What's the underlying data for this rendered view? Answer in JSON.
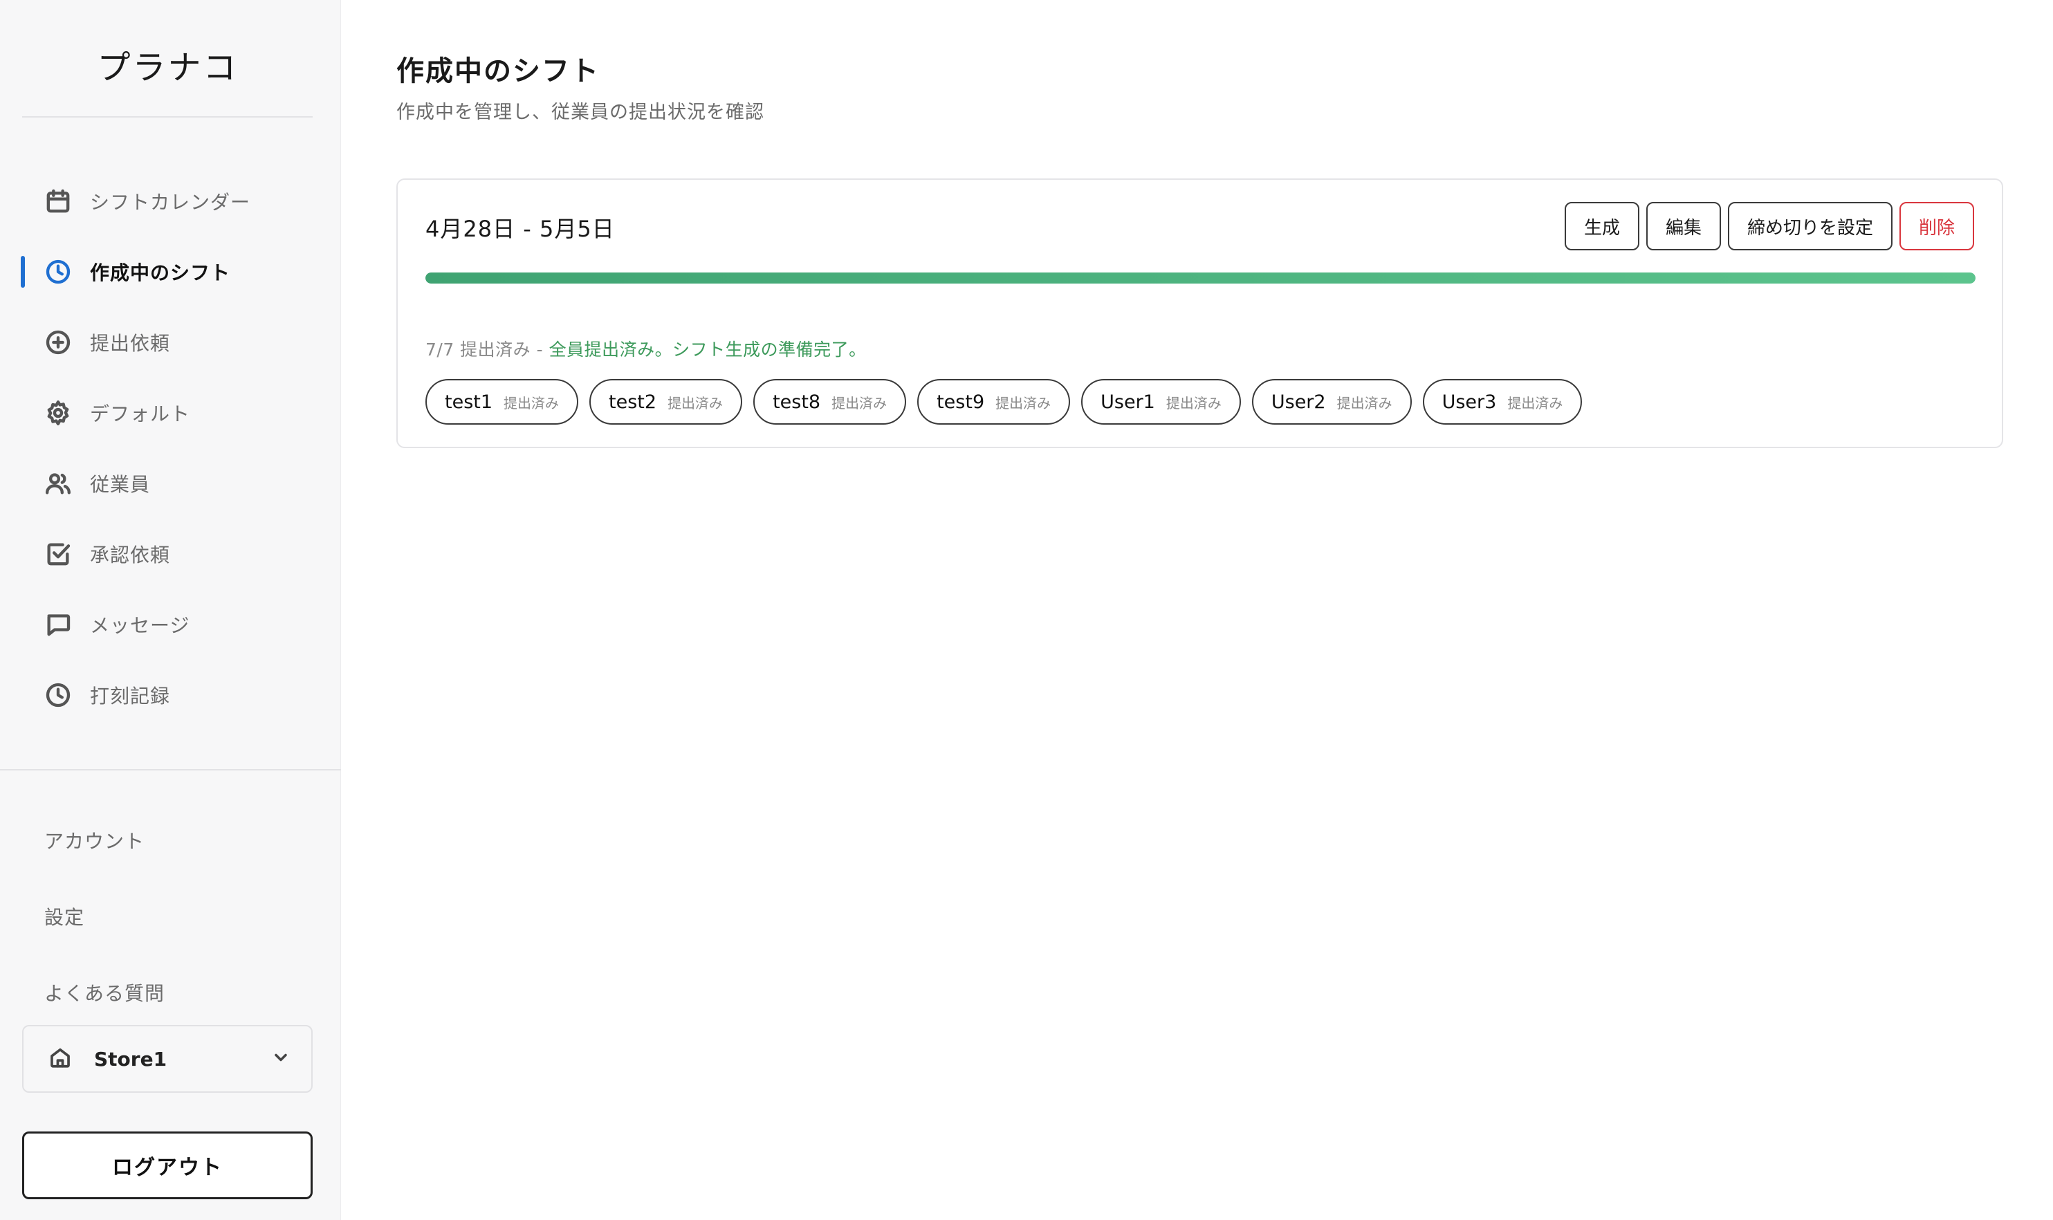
{
  "sidebar": {
    "brand": "プラナコ",
    "nav": [
      {
        "id": "calendar",
        "label": "シフトカレンダー",
        "icon": "calendar-icon",
        "active": false
      },
      {
        "id": "in-progress",
        "label": "作成中のシフト",
        "icon": "clock-icon",
        "active": true
      },
      {
        "id": "requests",
        "label": "提出依頼",
        "icon": "plus-circle-icon",
        "active": false
      },
      {
        "id": "default",
        "label": "デフォルト",
        "icon": "gear-icon",
        "active": false
      },
      {
        "id": "employees",
        "label": "従業員",
        "icon": "users-icon",
        "active": false
      },
      {
        "id": "approvals",
        "label": "承認依頼",
        "icon": "check-square-icon",
        "active": false
      },
      {
        "id": "messages",
        "label": "メッセージ",
        "icon": "message-icon",
        "active": false
      },
      {
        "id": "timecard",
        "label": "打刻記録",
        "icon": "clock-icon",
        "active": false
      }
    ],
    "sub_nav": [
      "アカウント",
      "設定",
      "よくある質問"
    ],
    "store": {
      "name": "Store1",
      "icon": "home-icon"
    },
    "logout_label": "ログアウト"
  },
  "main": {
    "title": "作成中のシフト",
    "subtitle": "作成中を管理し、従業員の提出状況を確認"
  },
  "shift_card": {
    "period": "4月28日 - 5月5日",
    "actions": {
      "generate": "生成",
      "edit": "編集",
      "deadline": "締め切りを設定",
      "delete": "削除"
    },
    "progress": 1.0,
    "status_count": "7/7 提出済み - ",
    "status_message": "全員提出済み。シフト生成の準備完了。",
    "employees": [
      {
        "name": "test1",
        "status": "提出済み"
      },
      {
        "name": "test2",
        "status": "提出済み"
      },
      {
        "name": "test8",
        "status": "提出済み"
      },
      {
        "name": "test9",
        "status": "提出済み"
      },
      {
        "name": "User1",
        "status": "提出済み"
      },
      {
        "name": "User2",
        "status": "提出済み"
      },
      {
        "name": "User3",
        "status": "提出済み"
      }
    ]
  },
  "colors": {
    "accent": "#1f6fd1",
    "progress": "#4cb781",
    "success_text": "#3d9a5b",
    "danger": "#d9363e"
  }
}
